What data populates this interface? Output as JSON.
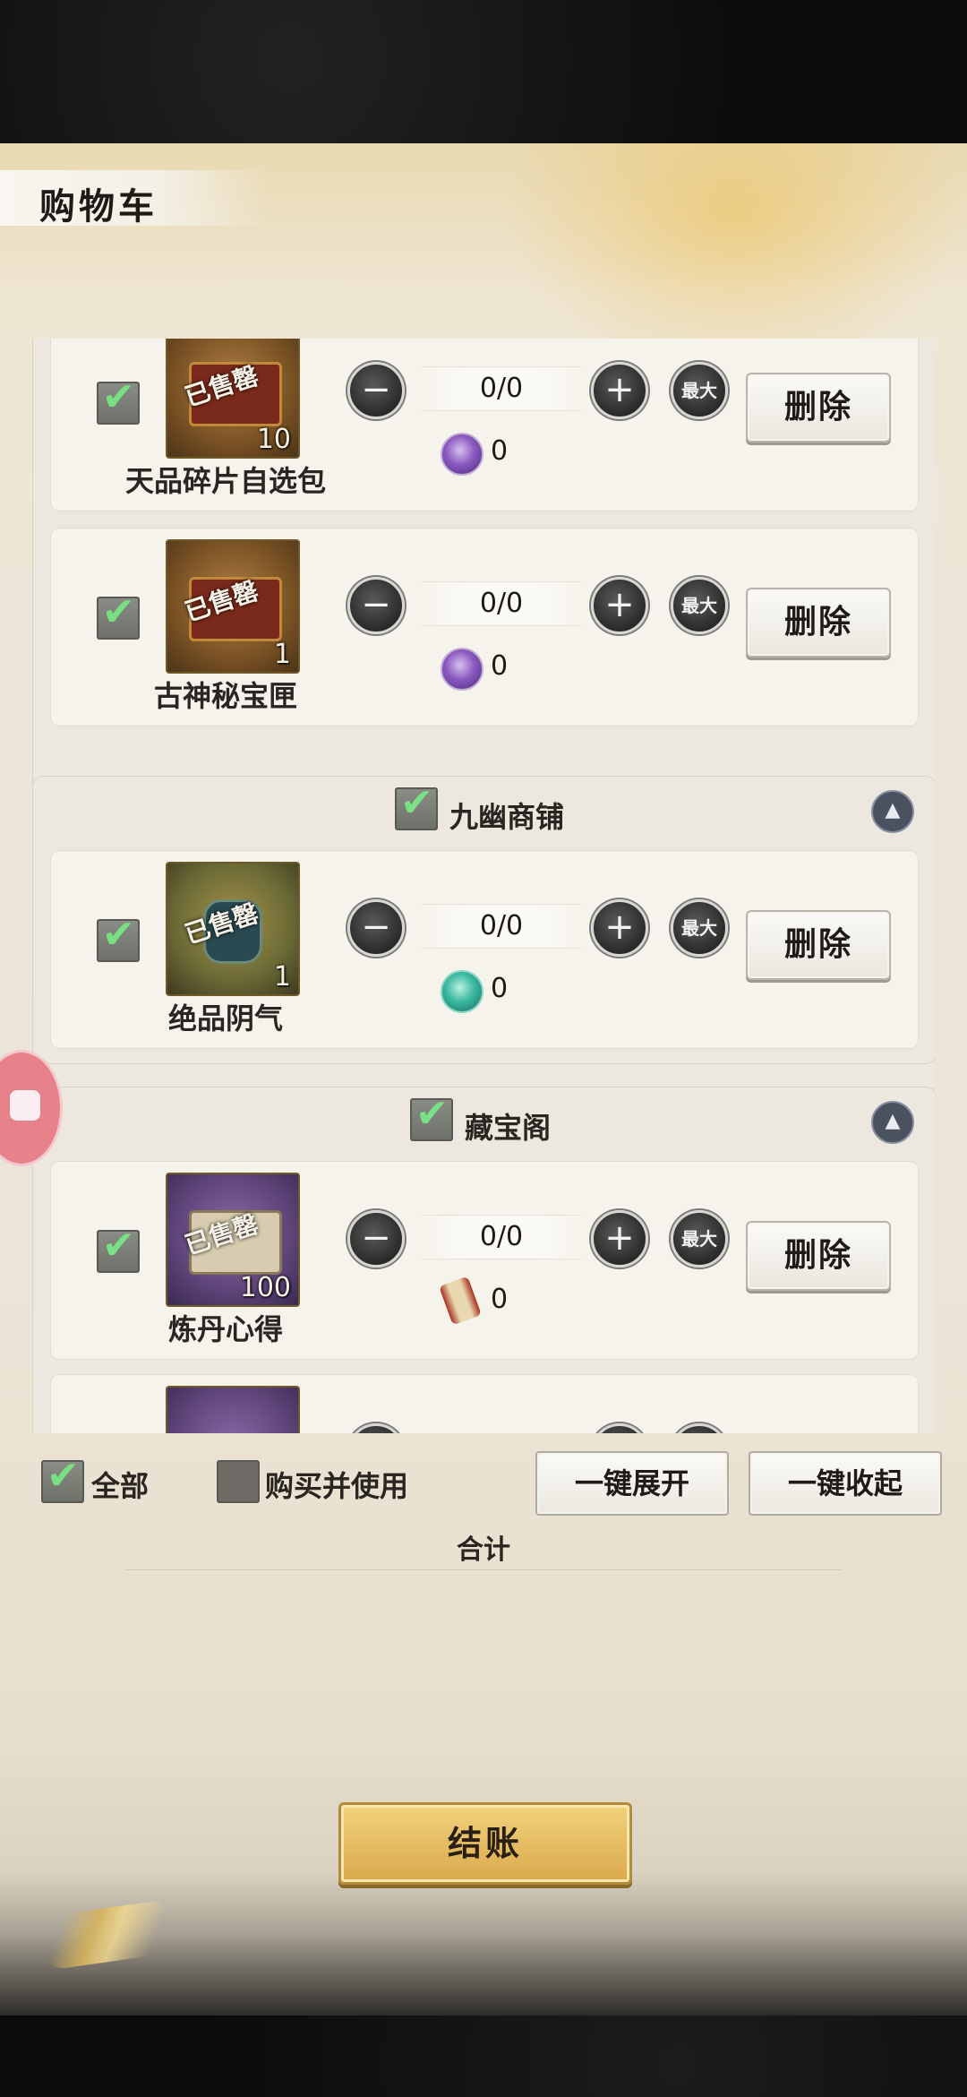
{
  "title": "购物车",
  "labels": {
    "sold_stamp": "已售罄",
    "max": "最大",
    "delete": "删除",
    "minus": "−",
    "plus": "+",
    "collapse_glyph": "▲"
  },
  "groups": [
    {
      "name": "",
      "items": [
        {
          "name": "天品碎片自选包",
          "qty_badge": "10",
          "quantity": "0/0",
          "price": "0",
          "currency_icon": "purple-coin-icon",
          "checked": true
        },
        {
          "name": "古神秘宝匣",
          "qty_badge": "1",
          "quantity": "0/0",
          "price": "0",
          "currency_icon": "purple-coin-icon",
          "checked": true
        }
      ]
    },
    {
      "name": "九幽商铺",
      "checked": true,
      "items": [
        {
          "name": "绝品阴气",
          "qty_badge": "1",
          "quantity": "0/0",
          "price": "0",
          "currency_icon": "jade-dragon-icon",
          "checked": true
        }
      ]
    },
    {
      "name": "藏宝阁",
      "checked": true,
      "items": [
        {
          "name": "炼丹心得",
          "qty_badge": "100",
          "quantity": "0/0",
          "price": "0",
          "currency_icon": "scroll-icon",
          "checked": true
        }
      ]
    }
  ],
  "footer": {
    "select_all": "全部",
    "select_all_checked": true,
    "buy_and_use": "购买并使用",
    "buy_and_use_checked": false,
    "expand_all": "一键展开",
    "collapse_all": "一键收起",
    "total_label": "合计",
    "checkout": "结账"
  }
}
